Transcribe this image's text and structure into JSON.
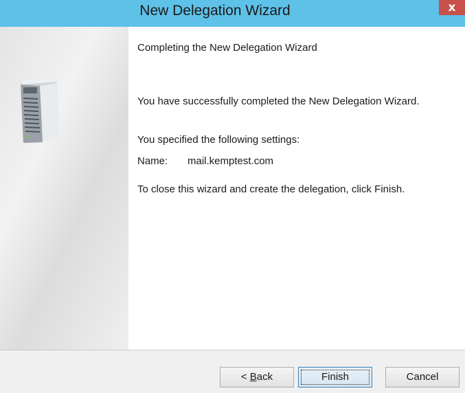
{
  "window": {
    "title": "New Delegation Wizard",
    "close_glyph": "x"
  },
  "sidebar": {
    "icon": "server-tower-icon"
  },
  "content": {
    "heading": "Completing the New Delegation Wizard",
    "success_text": "You have successfully completed the New Delegation Wizard.",
    "specified_text": "You specified the following settings:",
    "name_label": "Name:",
    "name_value": "mail.kemptest.com",
    "close_hint": "To close this wizard and create the delegation, click Finish."
  },
  "buttons": {
    "back_prefix": "< ",
    "back_mnemonic": "B",
    "back_suffix": "ack",
    "finish": "Finish",
    "cancel": "Cancel"
  },
  "colors": {
    "titlebar": "#5ec1e8",
    "close_button": "#c7504b",
    "footer": "#f0f0f0"
  }
}
